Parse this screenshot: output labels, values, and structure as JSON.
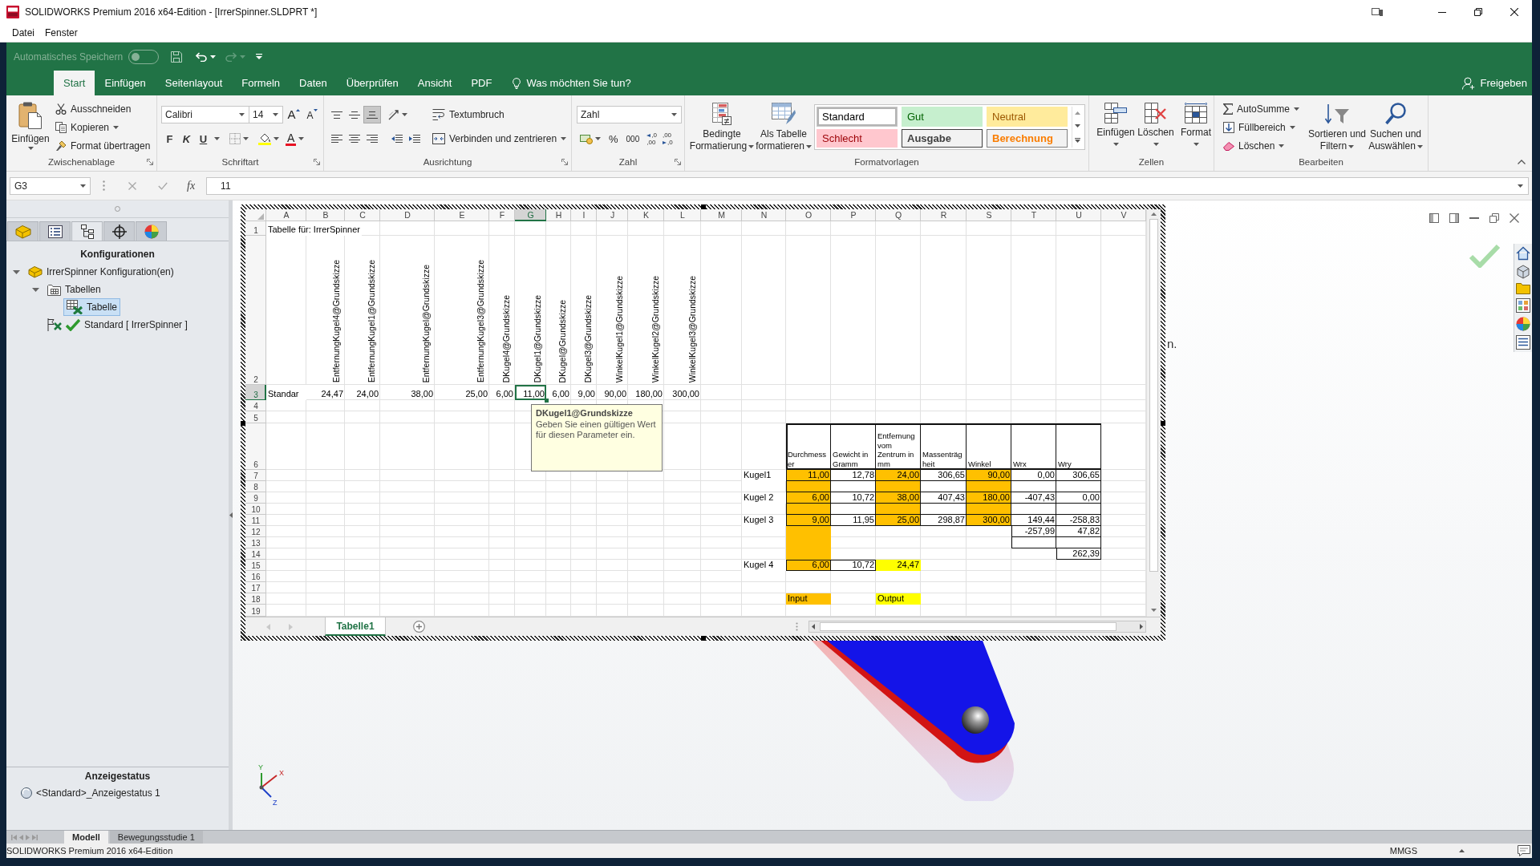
{
  "window": {
    "title": "SOLIDWORKS Premium 2016 x64-Edition - [IrrerSpinner.SLDPRT *]"
  },
  "menu": [
    {
      "label": "Datei"
    },
    {
      "label": "Fenster"
    }
  ],
  "excel": {
    "quick_access": {
      "autosave_label": "Automatisches Speichern",
      "autosave_on": false,
      "redo_disabled": true
    },
    "tabs": [
      {
        "label": "Start",
        "selected": true
      },
      {
        "label": "Einfügen",
        "selected": false
      },
      {
        "label": "Seitenlayout",
        "selected": false
      },
      {
        "label": "Formeln",
        "selected": false
      },
      {
        "label": "Daten",
        "selected": false
      },
      {
        "label": "Überprüfen",
        "selected": false
      },
      {
        "label": "Ansicht",
        "selected": false
      },
      {
        "label": "PDF",
        "selected": false
      }
    ],
    "tell_me": "Was möchten Sie tun?",
    "share": "Freigeben",
    "clipboard": {
      "label": "Zwischenablage",
      "paste": "Einfügen",
      "items": [
        {
          "kind": "cut",
          "label": "Ausschneiden"
        },
        {
          "kind": "copy",
          "label": "Kopieren"
        },
        {
          "kind": "painter",
          "label": "Format übertragen"
        }
      ]
    },
    "font": {
      "label": "Schriftart",
      "name": "Calibri",
      "size": "14",
      "grow": "A",
      "shrink": "A",
      "styles": [
        "F",
        "K",
        "U"
      ],
      "color_glyph": "A"
    },
    "alignment": {
      "label": "Ausrichtung",
      "vertical": [
        {
          "kind": "top",
          "selected": false
        },
        {
          "kind": "middle",
          "selected": false
        },
        {
          "kind": "bottom",
          "selected": true
        }
      ],
      "horizontal": [
        {
          "kind": "left",
          "selected": false
        },
        {
          "kind": "center",
          "selected": false
        },
        {
          "kind": "right",
          "selected": false
        }
      ],
      "wrap": "Textumbruch",
      "merge": "Verbinden und zentrieren"
    },
    "number": {
      "label": "Zahl",
      "format": "Zahl",
      "percent": "%",
      "thousands": "000",
      "increase_decimal": [
        ",0",
        ",00"
      ],
      "decrease_decimal": [
        ",00",
        ",0"
      ]
    },
    "styles": {
      "label": "Formatvorlagen",
      "conditional": "Bedingte Formatierung",
      "as_table": "Als Tabelle formatieren",
      "cells": [
        {
          "kind": "standard",
          "label": "Standard",
          "selected": true
        },
        {
          "kind": "good",
          "label": "Gut",
          "selected": false
        },
        {
          "kind": "neutral",
          "label": "Neutral",
          "selected": false
        },
        {
          "kind": "bad",
          "label": "Schlecht",
          "selected": false
        },
        {
          "kind": "output",
          "label": "Ausgabe",
          "selected": false
        },
        {
          "kind": "calculation",
          "label": "Berechnung",
          "selected": false
        }
      ]
    },
    "cells": {
      "label": "Zellen",
      "buttons": [
        {
          "kind": "insert",
          "label": "Einfügen"
        },
        {
          "kind": "delete",
          "label": "Löschen"
        },
        {
          "kind": "format",
          "label": "Format"
        }
      ]
    },
    "editing": {
      "label": "Bearbeiten",
      "items": [
        {
          "kind": "autosum",
          "label": "AutoSumme"
        },
        {
          "kind": "fill",
          "label": "Füllbereich"
        },
        {
          "kind": "clear",
          "label": "Löschen"
        }
      ],
      "sort": "Sortieren und Filtern",
      "find": "Suchen und Auswählen"
    },
    "formula_bar": {
      "name_box": "G3",
      "function": "fx",
      "value": "11"
    },
    "sheet": {
      "columns": [
        {
          "label": "A",
          "selected": false
        },
        {
          "label": "B",
          "selected": false
        },
        {
          "label": "C",
          "selected": false
        },
        {
          "label": "D",
          "selected": false
        },
        {
          "label": "E",
          "selected": false
        },
        {
          "label": "F",
          "selected": false
        },
        {
          "label": "G",
          "selected": true
        },
        {
          "label": "H",
          "selected": false
        },
        {
          "label": "I",
          "selected": false
        },
        {
          "label": "J",
          "selected": false
        },
        {
          "label": "K",
          "selected": false
        },
        {
          "label": "L",
          "selected": false
        },
        {
          "label": "M",
          "selected": false
        },
        {
          "label": "N",
          "selected": false
        },
        {
          "label": "O",
          "selected": false
        },
        {
          "label": "P",
          "selected": false
        },
        {
          "label": "Q",
          "selected": false
        },
        {
          "label": "R",
          "selected": false
        },
        {
          "label": "S",
          "selected": false
        },
        {
          "label": "T",
          "selected": false
        },
        {
          "label": "U",
          "selected": false
        },
        {
          "label": "V",
          "selected": false
        }
      ],
      "rows": [
        {
          "number": "1",
          "selected": false,
          "cells": [
            {
              "kind": "text",
              "text": "Tabelle für: IrrerSpinner"
            }
          ]
        },
        {
          "number": "2",
          "selected": false,
          "cells": [
            {},
            {
              "kind": "vertical",
              "text": "EntfernungKugel4@Grundskizze"
            },
            {
              "kind": "vertical",
              "text": "EntfernungKugel1@Grundskizze"
            },
            {
              "kind": "vertical",
              "text": "EntfernungKugel@Grundskizze"
            },
            {
              "kind": "vertical",
              "text": "EntfernungKugel3@Grundskizze"
            },
            {
              "kind": "vertical",
              "text": "DKugel4@Grundskizze"
            },
            {
              "kind": "vertical",
              "text": "DKugel1@Grundskizze"
            },
            {
              "kind": "vertical",
              "text": "DKugel@Grundskizze"
            },
            {
              "kind": "vertical",
              "text": "DKugel3@Grundskizze"
            },
            {
              "kind": "vertical",
              "text": "WinkelKugel1@Grundskizze"
            },
            {
              "kind": "vertical",
              "text": "WinkelKugel2@Grundskizze"
            },
            {
              "kind": "vertical",
              "text": "WinkelKugel3@Grundskizze"
            }
          ]
        },
        {
          "number": "3",
          "selected": true,
          "cells": [
            {
              "kind": "text",
              "text": "Standar"
            },
            {
              "kind": "number",
              "text": "24,47"
            },
            {
              "kind": "number",
              "text": "24,00"
            },
            {
              "kind": "number",
              "text": "38,00"
            },
            {
              "kind": "number",
              "text": "25,00"
            },
            {
              "kind": "number",
              "text": "6,00"
            },
            {
              "kind": "number",
              "text": "11,00"
            },
            {
              "kind": "number",
              "text": "6,00"
            },
            {
              "kind": "number",
              "text": "9,00"
            },
            {
              "kind": "number",
              "text": "90,00"
            },
            {
              "kind": "number",
              "text": "180,00"
            },
            {
              "kind": "number",
              "text": "300,00"
            }
          ]
        },
        {
          "number": "4",
          "selected": false
        },
        {
          "number": "5",
          "selected": false
        },
        {
          "number": "6",
          "selected": false,
          "cells": [
            {},
            {},
            {},
            {},
            {},
            {},
            {},
            {},
            {},
            {},
            {},
            {},
            {},
            {},
            {
              "kind": "heading",
              "text": "Durchmesser"
            },
            {
              "kind": "heading",
              "text": "Gewicht in Gramm"
            },
            {
              "kind": "heading",
              "text": "Entfernung vom Zentrum in mm"
            },
            {
              "kind": "heading",
              "text": "Massenträgheit"
            },
            {
              "kind": "heading",
              "text": "Winkel"
            },
            {
              "kind": "heading",
              "text": "Wrx"
            },
            {
              "kind": "heading",
              "text": "Wry"
            }
          ]
        },
        {
          "number": "7",
          "selected": false,
          "cells": [
            {},
            {},
            {},
            {},
            {},
            {},
            {},
            {},
            {},
            {},
            {},
            {},
            {},
            {
              "kind": "text",
              "text": "Kugel1"
            },
            {
              "kind": "number",
              "text": "11,00",
              "color": "#ffc000",
              "boxed": true
            },
            {
              "kind": "number",
              "text": "12,78",
              "boxed": true
            },
            {
              "kind": "number",
              "text": "24,00",
              "color": "#ffc000",
              "boxed": true
            },
            {
              "kind": "number",
              "text": "306,65",
              "boxed": true
            },
            {
              "kind": "number",
              "text": "90,00",
              "color": "#ffc000",
              "boxed": true
            },
            {
              "kind": "number",
              "text": "0,00",
              "boxed": true
            },
            {
              "kind": "number",
              "text": "306,65",
              "boxed": true
            }
          ]
        },
        {
          "number": "8",
          "selected": false,
          "cells": [
            {},
            {},
            {},
            {},
            {},
            {},
            {},
            {},
            {},
            {},
            {},
            {},
            {},
            {},
            {
              "color": "#ffc000",
              "boxed": true
            },
            {
              "boxed": true
            },
            {
              "color": "#ffc000",
              "boxed": true
            },
            {
              "boxed": true
            },
            {
              "color": "#ffc000",
              "boxed": true
            },
            {
              "boxed": true
            },
            {
              "boxed": true
            }
          ]
        },
        {
          "number": "9",
          "selected": false,
          "cells": [
            {},
            {},
            {},
            {},
            {},
            {},
            {},
            {},
            {},
            {},
            {},
            {},
            {},
            {
              "kind": "text",
              "text": "Kugel 2"
            },
            {
              "kind": "number",
              "text": "6,00",
              "color": "#ffc000",
              "boxed": true
            },
            {
              "kind": "number",
              "text": "10,72",
              "boxed": true
            },
            {
              "kind": "number",
              "text": "38,00",
              "color": "#ffc000",
              "boxed": true
            },
            {
              "kind": "number",
              "text": "407,43",
              "boxed": true
            },
            {
              "kind": "number",
              "text": "180,00",
              "color": "#ffc000",
              "boxed": true
            },
            {
              "kind": "number",
              "text": "-407,43",
              "boxed": true
            },
            {
              "kind": "number",
              "text": "0,00",
              "boxed": true
            }
          ]
        },
        {
          "number": "10",
          "selected": false,
          "cells": [
            {},
            {},
            {},
            {},
            {},
            {},
            {},
            {},
            {},
            {},
            {},
            {},
            {},
            {},
            {
              "color": "#ffc000",
              "boxed": true
            },
            {
              "boxed": true
            },
            {
              "color": "#ffc000",
              "boxed": true
            },
            {
              "boxed": true
            },
            {
              "color": "#ffc000",
              "boxed": true
            },
            {
              "boxed": true
            },
            {
              "boxed": true
            }
          ]
        },
        {
          "number": "11",
          "selected": false,
          "cells": [
            {},
            {},
            {},
            {},
            {},
            {},
            {},
            {},
            {},
            {},
            {},
            {},
            {},
            {
              "kind": "text",
              "text": "Kugel 3"
            },
            {
              "kind": "number",
              "text": "9,00",
              "color": "#ffc000",
              "boxed": true
            },
            {
              "kind": "number",
              "text": "11,95",
              "boxed": true
            },
            {
              "kind": "number",
              "text": "25,00",
              "color": "#ffc000",
              "boxed": true
            },
            {
              "kind": "number",
              "text": "298,87",
              "boxed": true
            },
            {
              "kind": "number",
              "text": "300,00",
              "color": "#ffc000",
              "boxed": true
            },
            {
              "kind": "number",
              "text": "149,44",
              "boxed": true
            },
            {
              "kind": "number",
              "text": "-258,83",
              "boxed": true
            }
          ]
        },
        {
          "number": "12",
          "selected": false,
          "cells": [
            {},
            {},
            {},
            {},
            {},
            {},
            {},
            {},
            {},
            {},
            {},
            {},
            {},
            {},
            {
              "color": "#ffc000"
            },
            {},
            {},
            {},
            {},
            {
              "kind": "number",
              "text": "-257,99",
              "boxed": true
            },
            {
              "kind": "number",
              "text": "47,82",
              "boxed": true
            }
          ]
        },
        {
          "number": "13",
          "selected": false,
          "cells": [
            {},
            {},
            {},
            {},
            {},
            {},
            {},
            {},
            {},
            {},
            {},
            {},
            {},
            {},
            {
              "color": "#ffc000"
            },
            {},
            {},
            {},
            {},
            {
              "boxed": true
            },
            {
              "boxed": true
            }
          ]
        },
        {
          "number": "14",
          "selected": false,
          "cells": [
            {},
            {},
            {},
            {},
            {},
            {},
            {},
            {},
            {},
            {},
            {},
            {},
            {},
            {},
            {
              "color": "#ffc000"
            },
            {},
            {},
            {},
            {},
            {},
            {
              "kind": "number",
              "text": "262,39",
              "boxed": true
            }
          ]
        },
        {
          "number": "15",
          "selected": false,
          "cells": [
            {},
            {},
            {},
            {},
            {},
            {},
            {},
            {},
            {},
            {},
            {},
            {},
            {},
            {
              "kind": "text",
              "text": "Kugel 4"
            },
            {
              "kind": "number",
              "text": "6,00",
              "color": "#ffc000",
              "boxed": true
            },
            {
              "kind": "number",
              "text": "10,72",
              "boxed": true
            },
            {
              "kind": "number",
              "text": "24,47",
              "color": "#ffff00"
            }
          ]
        },
        {
          "number": "16",
          "selected": false
        },
        {
          "number": "17",
          "selected": false
        },
        {
          "number": "18",
          "selected": false,
          "cells": [
            {},
            {},
            {},
            {},
            {},
            {},
            {},
            {},
            {},
            {},
            {},
            {},
            {},
            {},
            {
              "kind": "text",
              "text": "Input",
              "color": "#ffc000"
            },
            {},
            {
              "kind": "text",
              "text": "Output",
              "color": "#ffff00"
            }
          ]
        },
        {
          "number": "19",
          "selected": false
        }
      ],
      "tooltip": {
        "title": "DKugel1@Grundskizze",
        "text": "Geben Sie einen gültigen Wert für diesen Parameter ein."
      },
      "tabs": [
        {
          "label": "Tabelle1",
          "selected": true
        }
      ]
    }
  },
  "feature_manager": {
    "tabs": [
      {
        "kind": "feature",
        "selected": false
      },
      {
        "kind": "property",
        "selected": false
      },
      {
        "kind": "configuration",
        "selected": true
      },
      {
        "kind": "dimxpert",
        "selected": false
      },
      {
        "kind": "display",
        "selected": false
      }
    ],
    "heading": "Konfigurationen",
    "tree": [
      {
        "kind": "part",
        "label": "IrrerSpinner Konfiguration(en)",
        "expanded": true,
        "selected": false,
        "children": [
          {
            "kind": "folder",
            "label": "Tabellen",
            "expanded": true,
            "selected": false,
            "children": [
              {
                "kind": "table",
                "label": "Tabelle",
                "selected": true
              }
            ]
          },
          {
            "kind": "config",
            "label": "Standard [ IrrerSpinner ]",
            "selected": false,
            "active": true
          }
        ]
      }
    ],
    "display_heading": "Anzeigestatus",
    "display_states": [
      {
        "label": "<Standard>_Anzeigestatus 1"
      }
    ]
  },
  "graphics": {
    "fragment": "n.",
    "triad": [
      "X",
      "Y",
      "Z"
    ]
  },
  "bottom_tabs": [
    {
      "label": "Modell",
      "selected": true
    },
    {
      "label": "Bewegungsstudie 1",
      "selected": false
    }
  ],
  "status_bar": {
    "text": "SOLIDWORKS Premium 2016 x64-Edition",
    "units": "MMGS"
  }
}
